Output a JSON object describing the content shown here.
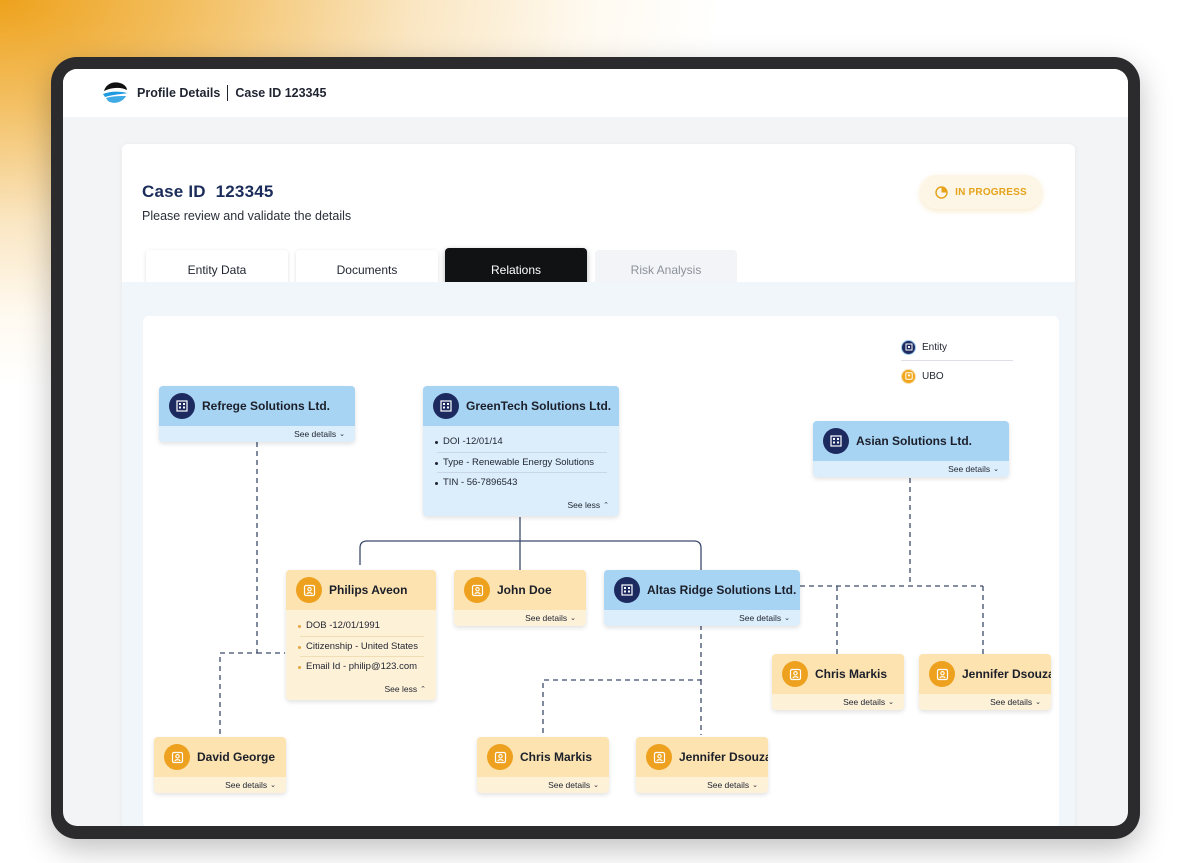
{
  "topbar": {
    "title": "Profile Details",
    "case_ref": "Case ID 123345"
  },
  "header": {
    "title": "Case ID  123345",
    "subtitle": "Please review and validate the details",
    "status": "IN PROGRESS",
    "status_icon": "pie-chart-icon"
  },
  "tabs": [
    {
      "label": "Entity Data",
      "state": "default"
    },
    {
      "label": "Documents",
      "state": "default"
    },
    {
      "label": "Relations",
      "state": "active"
    },
    {
      "label": "Risk Analysis",
      "state": "disabled"
    }
  ],
  "legend": {
    "entity_label": "Entity",
    "ubo_label": "UBO"
  },
  "nodes": {
    "refrege": {
      "name": "Refrege Solutions Ltd.",
      "toggle": "See details",
      "type": "entity"
    },
    "greentech": {
      "name": "GreenTech Solutions Ltd.",
      "toggle": "See less",
      "type": "entity",
      "details": [
        "DOI -12/01/14",
        "Type - Renewable Energy Solutions",
        "TIN - 56-7896543"
      ]
    },
    "asian": {
      "name": "Asian Solutions Ltd.",
      "toggle": "See details",
      "type": "entity"
    },
    "philips": {
      "name": "Philips Aveon",
      "toggle": "See less",
      "type": "ubo",
      "details": [
        "DOB -12/01/1991",
        "Citizenship - United States",
        "Email Id - philip@123.com"
      ]
    },
    "johndoe": {
      "name": "John Doe",
      "toggle": "See details",
      "type": "ubo"
    },
    "altas": {
      "name": "Altas Ridge Solutions Ltd.",
      "toggle": "See details",
      "type": "entity"
    },
    "chris_right": {
      "name": "Chris Markis",
      "toggle": "See details",
      "type": "ubo"
    },
    "jennifer_right": {
      "name": "Jennifer Dsouza",
      "toggle": "See details",
      "type": "ubo"
    },
    "david": {
      "name": "David George",
      "toggle": "See details",
      "type": "ubo"
    },
    "chris_mid": {
      "name": "Chris Markis",
      "toggle": "See details",
      "type": "ubo"
    },
    "jennifer_mid": {
      "name": "Jennifer Dsouza",
      "toggle": "See details",
      "type": "ubo"
    }
  },
  "colors": {
    "entity_head": "#a8d4f4",
    "entity_icon": "#1d2a60",
    "ubo_head": "#fde3b0",
    "ubo_icon": "#eda11e",
    "status_text": "#e5a21a",
    "active_tab": "#111214"
  }
}
